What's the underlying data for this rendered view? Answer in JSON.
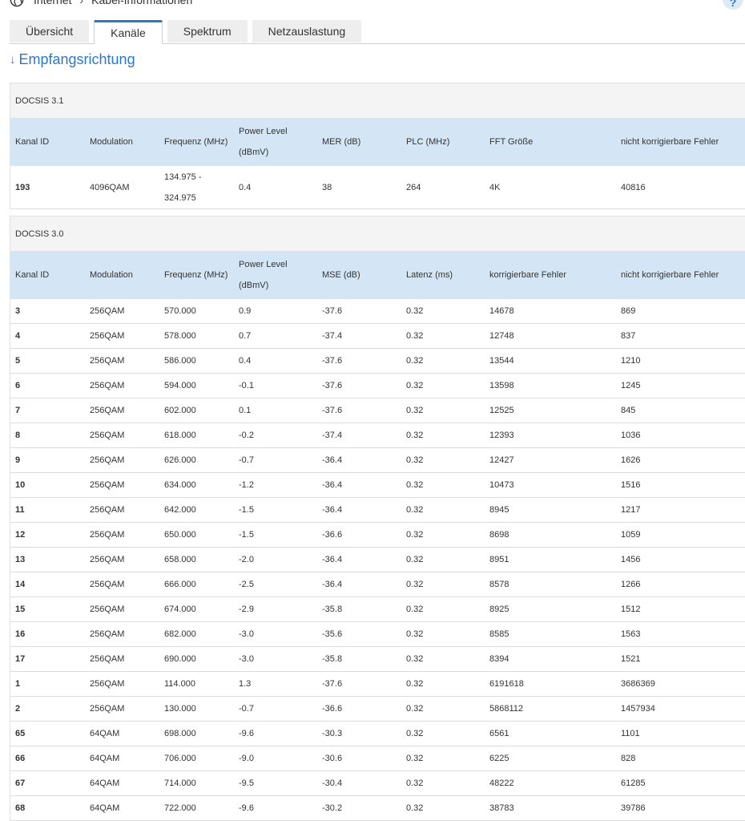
{
  "breadcrumb": {
    "root": "Internet",
    "current": "Kabel-Informationen"
  },
  "help_label": "?",
  "tabs": [
    {
      "label": "Übersicht",
      "active": false
    },
    {
      "label": "Kanäle",
      "active": true
    },
    {
      "label": "Spektrum",
      "active": false
    },
    {
      "label": "Netzauslastung",
      "active": false
    }
  ],
  "section_title": "Empfangsrichtung",
  "accent_color": "#2c78c8",
  "docsis31": {
    "title": "DOCSIS 3.1",
    "headers": [
      "Kanal ID",
      "Modulation",
      "Frequenz (MHz)",
      "Power Level (dBmV)",
      "MER (dB)",
      "PLC (MHz)",
      "FFT Größe",
      "nicht korrigierbare Fehler"
    ],
    "rows": [
      [
        "193",
        "4096QAM",
        "134.975 - 324.975",
        "0.4",
        "38",
        "264",
        "4K",
        "40816"
      ]
    ]
  },
  "docsis30": {
    "title": "DOCSIS 3.0",
    "headers": [
      "Kanal ID",
      "Modulation",
      "Frequenz (MHz)",
      "Power Level (dBmV)",
      "MSE (dB)",
      "Latenz (ms)",
      "korrigierbare Fehler",
      "nicht korrigierbare Fehler"
    ],
    "rows": [
      [
        "3",
        "256QAM",
        "570.000",
        "0.9",
        "-37.6",
        "0.32",
        "14678",
        "869"
      ],
      [
        "4",
        "256QAM",
        "578.000",
        "0.7",
        "-37.4",
        "0.32",
        "12748",
        "837"
      ],
      [
        "5",
        "256QAM",
        "586.000",
        "0.4",
        "-37.6",
        "0.32",
        "13544",
        "1210"
      ],
      [
        "6",
        "256QAM",
        "594.000",
        "-0.1",
        "-37.6",
        "0.32",
        "13598",
        "1245"
      ],
      [
        "7",
        "256QAM",
        "602.000",
        "0.1",
        "-37.6",
        "0.32",
        "12525",
        "845"
      ],
      [
        "8",
        "256QAM",
        "618.000",
        "-0.2",
        "-37.4",
        "0.32",
        "12393",
        "1036"
      ],
      [
        "9",
        "256QAM",
        "626.000",
        "-0.7",
        "-36.4",
        "0.32",
        "12427",
        "1626"
      ],
      [
        "10",
        "256QAM",
        "634.000",
        "-1.2",
        "-36.4",
        "0.32",
        "10473",
        "1516"
      ],
      [
        "11",
        "256QAM",
        "642.000",
        "-1.5",
        "-36.4",
        "0.32",
        "8945",
        "1217"
      ],
      [
        "12",
        "256QAM",
        "650.000",
        "-1.5",
        "-36.6",
        "0.32",
        "8698",
        "1059"
      ],
      [
        "13",
        "256QAM",
        "658.000",
        "-2.0",
        "-36.4",
        "0.32",
        "8951",
        "1456"
      ],
      [
        "14",
        "256QAM",
        "666.000",
        "-2.5",
        "-36.4",
        "0.32",
        "8578",
        "1266"
      ],
      [
        "15",
        "256QAM",
        "674.000",
        "-2.9",
        "-35.8",
        "0.32",
        "8925",
        "1512"
      ],
      [
        "16",
        "256QAM",
        "682.000",
        "-3.0",
        "-35.6",
        "0.32",
        "8585",
        "1563"
      ],
      [
        "17",
        "256QAM",
        "690.000",
        "-3.0",
        "-35.8",
        "0.32",
        "8394",
        "1521"
      ],
      [
        "1",
        "256QAM",
        "114.000",
        "1.3",
        "-37.6",
        "0.32",
        "6191618",
        "3686369"
      ],
      [
        "2",
        "256QAM",
        "130.000",
        "-0.7",
        "-36.6",
        "0.32",
        "5868112",
        "1457934"
      ],
      [
        "65",
        "64QAM",
        "698.000",
        "-9.6",
        "-30.3",
        "0.32",
        "6561",
        "1101"
      ],
      [
        "66",
        "64QAM",
        "706.000",
        "-9.0",
        "-30.6",
        "0.32",
        "6225",
        "828"
      ],
      [
        "67",
        "64QAM",
        "714.000",
        "-9.5",
        "-30.4",
        "0.32",
        "48222",
        "61285"
      ],
      [
        "68",
        "64QAM",
        "722.000",
        "-9.6",
        "-30.2",
        "0.32",
        "38783",
        "39786"
      ]
    ]
  }
}
